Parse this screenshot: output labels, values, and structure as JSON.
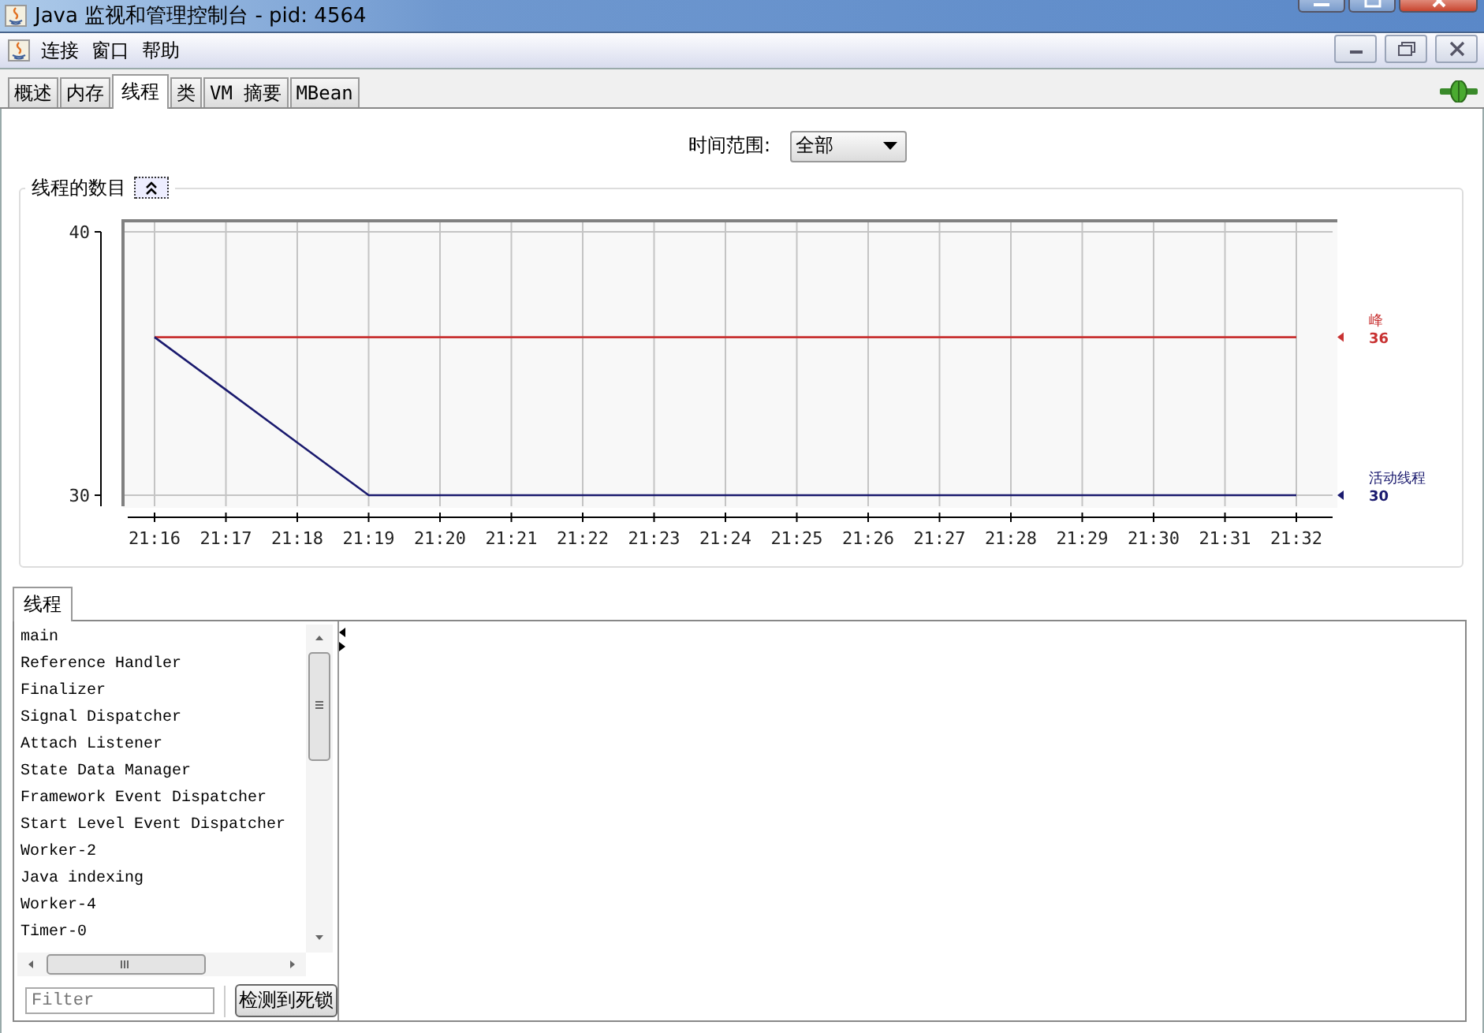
{
  "window": {
    "title": "Java 监视和管理控制台 - pid: 4564"
  },
  "menu": [
    "连接",
    "窗口",
    "帮助"
  ],
  "tabs": [
    {
      "label": "概述",
      "selected": false
    },
    {
      "label": "内存",
      "selected": false
    },
    {
      "label": "线程",
      "selected": true
    },
    {
      "label": "类",
      "selected": false
    },
    {
      "label": "VM 摘要",
      "selected": false
    },
    {
      "label": "MBean",
      "selected": false
    }
  ],
  "time_range": {
    "label": "时间范围:",
    "value": "全部"
  },
  "thread_count_panel": {
    "title": "线程的数目",
    "expanded": true,
    "chart_data": {
      "type": "line",
      "grid": true,
      "ylim": [
        30,
        40
      ],
      "yticks": [
        30,
        40
      ],
      "categories": [
        "21:16",
        "21:17",
        "21:18",
        "21:19",
        "21:20",
        "21:21",
        "21:22",
        "21:23",
        "21:24",
        "21:25",
        "21:26",
        "21:27",
        "21:28",
        "21:29",
        "21:30",
        "21:31",
        "21:32"
      ],
      "series": [
        {
          "name": "峰",
          "color": "#c83232",
          "values": [
            36,
            36,
            36,
            36,
            36,
            36,
            36,
            36,
            36,
            36,
            36,
            36,
            36,
            36,
            36,
            36,
            36
          ]
        },
        {
          "name": "活动线程",
          "color": "#1a1a6e",
          "values": [
            36,
            34,
            32,
            30,
            30,
            30,
            30,
            30,
            30,
            30,
            30,
            30,
            30,
            30,
            30,
            30,
            30
          ]
        }
      ]
    },
    "legend": [
      {
        "value": "36"
      },
      {
        "value": "30"
      }
    ]
  },
  "threads_panel": {
    "tab": "线程",
    "threads": [
      "main",
      "Reference Handler",
      "Finalizer",
      "Signal Dispatcher",
      "Attach Listener",
      "State Data Manager",
      "Framework Event Dispatcher",
      "Start Level Event Dispatcher",
      "Worker-2",
      "Java indexing",
      "Worker-4",
      "Timer-0"
    ],
    "filter": {
      "placeholder": "Filter"
    },
    "button": "检测到死锁"
  }
}
